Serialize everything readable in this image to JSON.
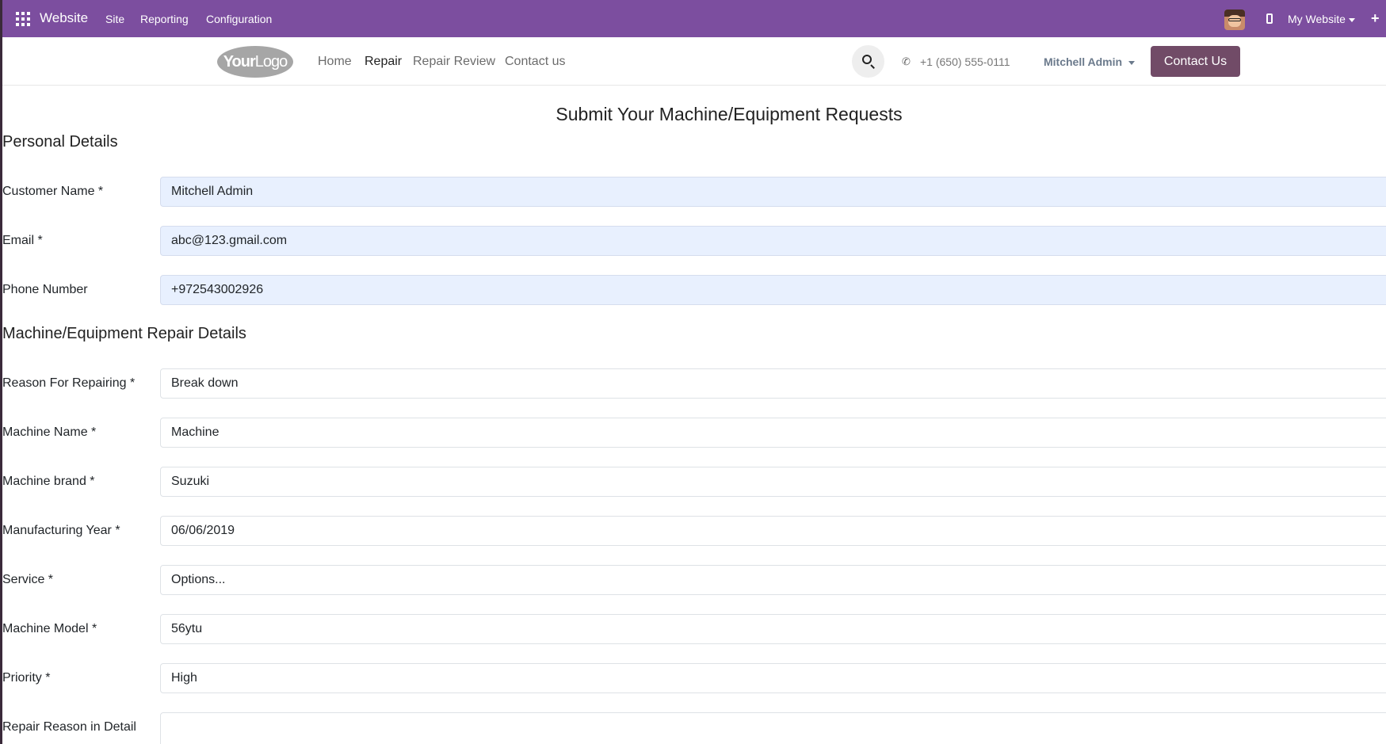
{
  "topbar": {
    "app_name": "Website",
    "menu": [
      "Site",
      "Reporting",
      "Configuration"
    ],
    "website_switch": "My Website",
    "new_label": "+"
  },
  "header": {
    "logo_text_bold": "Your",
    "logo_text": "Logo",
    "nav": [
      "Home",
      "Repair",
      "Repair Review",
      "Contact us"
    ],
    "active_nav": "Repair",
    "phone": "+1 (650) 555-0111",
    "user": "Mitchell Admin",
    "contact_button": "Contact Us"
  },
  "form": {
    "title": "Submit Your Machine/Equipment Requests",
    "personal_section": "Personal Details",
    "machine_section": "Machine/Equipment Repair Details",
    "customer_name": {
      "label": "Customer Name *",
      "value": "Mitchell Admin"
    },
    "email": {
      "label": "Email *",
      "value": "abc@123.gmail.com"
    },
    "phone": {
      "label": "Phone Number",
      "value": "+972543002926"
    },
    "reason": {
      "label": "Reason For Repairing *",
      "value": "Break down"
    },
    "machine_name": {
      "label": "Machine Name *",
      "value": "Machine"
    },
    "machine_brand": {
      "label": "Machine brand *",
      "value": "Suzuki"
    },
    "manufacturing_year": {
      "label": "Manufacturing Year *",
      "value": "06/06/2019"
    },
    "service": {
      "label": "Service *",
      "value": "Options..."
    },
    "machine_model": {
      "label": "Machine Model *",
      "value": "56ytu"
    },
    "priority": {
      "label": "Priority *",
      "value": "High"
    },
    "repair_detail": {
      "label": "Repair Reason in Detail",
      "value": ""
    }
  },
  "colors": {
    "admin_bar": "#7c4e9f",
    "primary_button": "#714b67",
    "autofill_bg": "#e8f0fe"
  }
}
